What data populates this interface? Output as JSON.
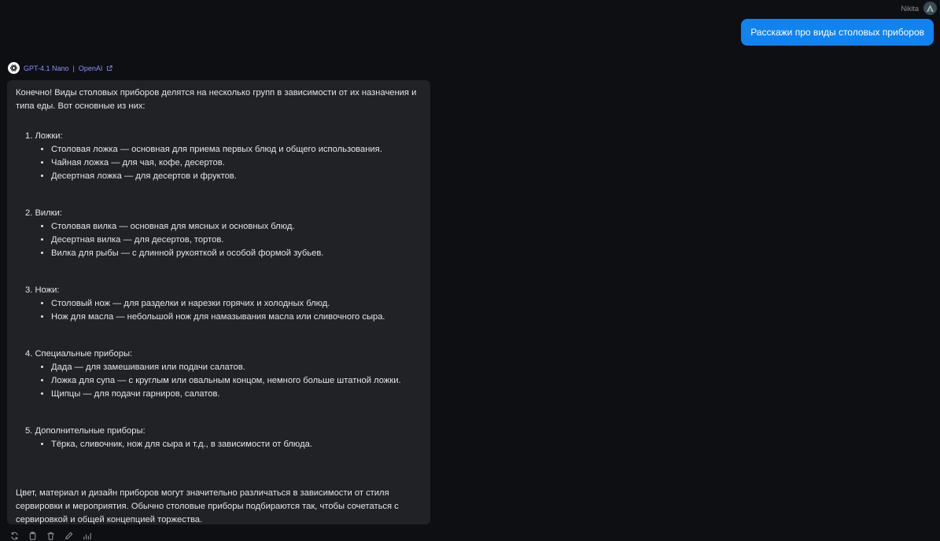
{
  "user": {
    "name": "Nikita",
    "avatar_icon": "user-avatar-icon",
    "message": "Расскажи про виды столовых приборов"
  },
  "assistant": {
    "model": "GPT-4.1 Nano",
    "separator": "|",
    "provider": "OpenAI",
    "intro": "Конечно! Виды столовых приборов делятся на несколько групп в зависимости от их назначения и типа еды. Вот основные из них:",
    "sections": [
      {
        "title": "1. Ложки:",
        "items": [
          "Столовая ложка — основная для приема первых блюд и общего использования.",
          "Чайная ложка — для чая, кофе, десертов.",
          "Десертная ложка — для десертов и фруктов."
        ]
      },
      {
        "title": "2. Вилки:",
        "items": [
          "Столовая вилка — основная для мясных и основных блюд.",
          "Десертная вилка — для десертов, тортов.",
          "Вилка для рыбы — с длинной рукояткой и особой формой зубьев."
        ]
      },
      {
        "title": "3. Ножи:",
        "items": [
          "Столовый нож — для разделки и нарезки горячих и холодных блюд.",
          "Нож для масла — небольшой нож для намазывания масла или сливочного сыра."
        ]
      },
      {
        "title": "4. Специальные приборы:",
        "items": [
          "Дада — для замешивания или подачи салатов.",
          "Ложка для супа — с круглым или овальным концом, немного больше штатной ложки.",
          "Щипцы — для подачи гарниров, салатов."
        ]
      },
      {
        "title": "5. Дополнительные приборы:",
        "items": [
          "Тёрка, сливочник, нож для сыра и т.д., в зависимости от блюда."
        ]
      }
    ],
    "outro": "Цвет, материал и дизайн приборов могут значительно различаться в зависимости от стиля сервировки и мероприятия. Обычно столовые приборы подбираются так, чтобы сочетаться с сервировкой и общей концепцией торжества."
  },
  "actions": [
    {
      "name": "regenerate-icon"
    },
    {
      "name": "copy-icon"
    },
    {
      "name": "delete-icon"
    },
    {
      "name": "edit-icon"
    },
    {
      "name": "stats-icon"
    }
  ],
  "colors": {
    "background": "#0e0f13",
    "user_bubble": "#1183f0",
    "assistant_bubble": "#202226",
    "model_link": "#8c8ff5"
  }
}
